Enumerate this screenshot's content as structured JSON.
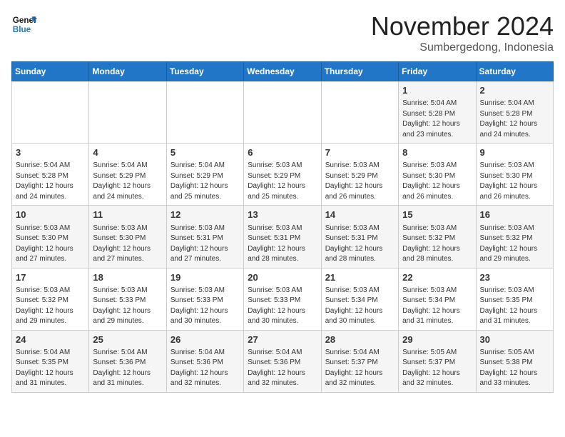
{
  "logo": {
    "line1": "General",
    "line2": "Blue"
  },
  "title": "November 2024",
  "subtitle": "Sumbergedong, Indonesia",
  "weekdays": [
    "Sunday",
    "Monday",
    "Tuesday",
    "Wednesday",
    "Thursday",
    "Friday",
    "Saturday"
  ],
  "weeks": [
    [
      {
        "day": "",
        "info": ""
      },
      {
        "day": "",
        "info": ""
      },
      {
        "day": "",
        "info": ""
      },
      {
        "day": "",
        "info": ""
      },
      {
        "day": "",
        "info": ""
      },
      {
        "day": "1",
        "info": "Sunrise: 5:04 AM\nSunset: 5:28 PM\nDaylight: 12 hours\nand 23 minutes."
      },
      {
        "day": "2",
        "info": "Sunrise: 5:04 AM\nSunset: 5:28 PM\nDaylight: 12 hours\nand 24 minutes."
      }
    ],
    [
      {
        "day": "3",
        "info": "Sunrise: 5:04 AM\nSunset: 5:28 PM\nDaylight: 12 hours\nand 24 minutes."
      },
      {
        "day": "4",
        "info": "Sunrise: 5:04 AM\nSunset: 5:29 PM\nDaylight: 12 hours\nand 24 minutes."
      },
      {
        "day": "5",
        "info": "Sunrise: 5:04 AM\nSunset: 5:29 PM\nDaylight: 12 hours\nand 25 minutes."
      },
      {
        "day": "6",
        "info": "Sunrise: 5:03 AM\nSunset: 5:29 PM\nDaylight: 12 hours\nand 25 minutes."
      },
      {
        "day": "7",
        "info": "Sunrise: 5:03 AM\nSunset: 5:29 PM\nDaylight: 12 hours\nand 26 minutes."
      },
      {
        "day": "8",
        "info": "Sunrise: 5:03 AM\nSunset: 5:30 PM\nDaylight: 12 hours\nand 26 minutes."
      },
      {
        "day": "9",
        "info": "Sunrise: 5:03 AM\nSunset: 5:30 PM\nDaylight: 12 hours\nand 26 minutes."
      }
    ],
    [
      {
        "day": "10",
        "info": "Sunrise: 5:03 AM\nSunset: 5:30 PM\nDaylight: 12 hours\nand 27 minutes."
      },
      {
        "day": "11",
        "info": "Sunrise: 5:03 AM\nSunset: 5:30 PM\nDaylight: 12 hours\nand 27 minutes."
      },
      {
        "day": "12",
        "info": "Sunrise: 5:03 AM\nSunset: 5:31 PM\nDaylight: 12 hours\nand 27 minutes."
      },
      {
        "day": "13",
        "info": "Sunrise: 5:03 AM\nSunset: 5:31 PM\nDaylight: 12 hours\nand 28 minutes."
      },
      {
        "day": "14",
        "info": "Sunrise: 5:03 AM\nSunset: 5:31 PM\nDaylight: 12 hours\nand 28 minutes."
      },
      {
        "day": "15",
        "info": "Sunrise: 5:03 AM\nSunset: 5:32 PM\nDaylight: 12 hours\nand 28 minutes."
      },
      {
        "day": "16",
        "info": "Sunrise: 5:03 AM\nSunset: 5:32 PM\nDaylight: 12 hours\nand 29 minutes."
      }
    ],
    [
      {
        "day": "17",
        "info": "Sunrise: 5:03 AM\nSunset: 5:32 PM\nDaylight: 12 hours\nand 29 minutes."
      },
      {
        "day": "18",
        "info": "Sunrise: 5:03 AM\nSunset: 5:33 PM\nDaylight: 12 hours\nand 29 minutes."
      },
      {
        "day": "19",
        "info": "Sunrise: 5:03 AM\nSunset: 5:33 PM\nDaylight: 12 hours\nand 30 minutes."
      },
      {
        "day": "20",
        "info": "Sunrise: 5:03 AM\nSunset: 5:33 PM\nDaylight: 12 hours\nand 30 minutes."
      },
      {
        "day": "21",
        "info": "Sunrise: 5:03 AM\nSunset: 5:34 PM\nDaylight: 12 hours\nand 30 minutes."
      },
      {
        "day": "22",
        "info": "Sunrise: 5:03 AM\nSunset: 5:34 PM\nDaylight: 12 hours\nand 31 minutes."
      },
      {
        "day": "23",
        "info": "Sunrise: 5:03 AM\nSunset: 5:35 PM\nDaylight: 12 hours\nand 31 minutes."
      }
    ],
    [
      {
        "day": "24",
        "info": "Sunrise: 5:04 AM\nSunset: 5:35 PM\nDaylight: 12 hours\nand 31 minutes."
      },
      {
        "day": "25",
        "info": "Sunrise: 5:04 AM\nSunset: 5:36 PM\nDaylight: 12 hours\nand 31 minutes."
      },
      {
        "day": "26",
        "info": "Sunrise: 5:04 AM\nSunset: 5:36 PM\nDaylight: 12 hours\nand 32 minutes."
      },
      {
        "day": "27",
        "info": "Sunrise: 5:04 AM\nSunset: 5:36 PM\nDaylight: 12 hours\nand 32 minutes."
      },
      {
        "day": "28",
        "info": "Sunrise: 5:04 AM\nSunset: 5:37 PM\nDaylight: 12 hours\nand 32 minutes."
      },
      {
        "day": "29",
        "info": "Sunrise: 5:05 AM\nSunset: 5:37 PM\nDaylight: 12 hours\nand 32 minutes."
      },
      {
        "day": "30",
        "info": "Sunrise: 5:05 AM\nSunset: 5:38 PM\nDaylight: 12 hours\nand 33 minutes."
      }
    ]
  ]
}
